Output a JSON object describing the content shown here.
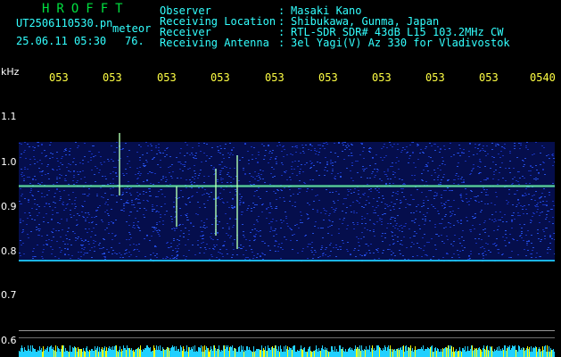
{
  "header": {
    "logo": "HROFFT",
    "filename": "UT2506110530.pn",
    "meteor_label": "meteor",
    "datetime": "25.06.11 05:30",
    "count": "76.",
    "fields": [
      {
        "label": "Observer",
        "value": "Masaki Kano"
      },
      {
        "label": "Receiving Location",
        "value": "Shibukawa, Gunma, Japan"
      },
      {
        "label": "Receiver",
        "value": "RTL-SDR SDR# 43dB L15 103.2MHz CW"
      },
      {
        "label": "Receiving Antenna",
        "value": "3el Yagi(V) Az 330 for Vladivostok"
      }
    ],
    "separator": ":"
  },
  "axes": {
    "y_unit": "kHz",
    "y_ticks": [
      "1.1",
      "1.0",
      "0.9",
      "0.8",
      "0.7",
      "0.6"
    ],
    "x_ticks": [
      "053",
      "053",
      "053",
      "053",
      "053",
      "053",
      "053",
      "053",
      "053",
      "0540"
    ]
  },
  "colors": {
    "background": "#000000",
    "text_white": "#ffffff",
    "text_cyan": "#33ffff",
    "text_yellow": "#ffff00",
    "logo_green": "#00e040",
    "noise_low": "#0a1a8a",
    "noise_high": "#2a5cff",
    "signal": "#4cff9a",
    "baseline": "#20d0ff"
  }
}
